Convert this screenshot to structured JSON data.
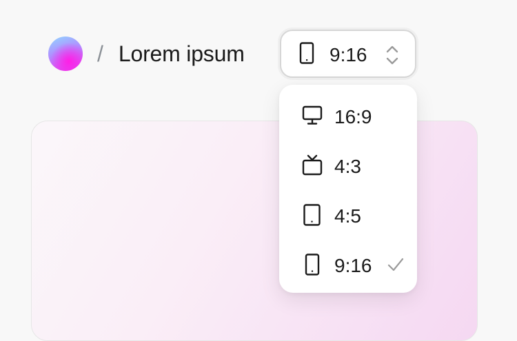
{
  "breadcrumb": {
    "avatar_icon": "gradient-avatar",
    "separator": "/",
    "title": "Lorem ipsum"
  },
  "aspect_select": {
    "value": "9:16",
    "icon": "phone-portrait-icon",
    "chevron_icon": "chevron-up-down-icon"
  },
  "dropdown": {
    "options": [
      {
        "label": "16:9",
        "icon": "monitor-icon",
        "selected": false
      },
      {
        "label": "4:3",
        "icon": "tv-icon",
        "selected": false
      },
      {
        "label": "4:5",
        "icon": "tablet-icon",
        "selected": false
      },
      {
        "label": "9:16",
        "icon": "phone-icon",
        "selected": true
      }
    ],
    "check_icon": "checkmark-icon"
  },
  "colors": {
    "background": "#f8f8f8",
    "card_gradient_start": "#fbf7fa",
    "card_gradient_end": "#f5d8f2",
    "avatar_pink": "#ff1ee6",
    "avatar_blue": "#8fd8ff",
    "check": "#9a9a9a"
  }
}
